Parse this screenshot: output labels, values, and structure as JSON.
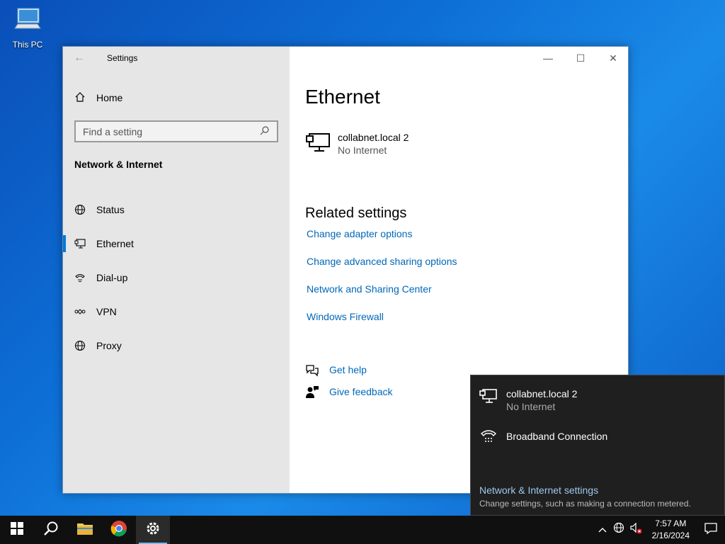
{
  "desktop": {
    "icon_label": "This PC"
  },
  "window": {
    "app_title": "Settings",
    "home_label": "Home",
    "search_placeholder": "Find a setting",
    "section_title": "Network & Internet",
    "nav": [
      {
        "label": "Status",
        "icon": "globe-icon"
      },
      {
        "label": "Ethernet",
        "icon": "ethernet-icon"
      },
      {
        "label": "Dial-up",
        "icon": "dialup-icon"
      },
      {
        "label": "VPN",
        "icon": "vpn-icon"
      },
      {
        "label": "Proxy",
        "icon": "globe-icon"
      }
    ],
    "active_nav": "Ethernet",
    "page_title": "Ethernet",
    "adapter": {
      "name": "collabnet.local 2",
      "status": "No Internet"
    },
    "related_title": "Related settings",
    "related_links": [
      "Change adapter options",
      "Change advanced sharing options",
      "Network and Sharing Center",
      "Windows Firewall"
    ],
    "help": {
      "get_help": "Get help",
      "feedback": "Give feedback"
    }
  },
  "flyout": {
    "network": {
      "name": "collabnet.local 2",
      "status": "No Internet"
    },
    "broadband": "Broadband Connection",
    "settings_title": "Network & Internet settings",
    "settings_desc": "Change settings, such as making a connection metered."
  },
  "taskbar": {
    "time": "7:57 AM",
    "date": "2/16/2024"
  },
  "colors": {
    "accent": "#0078d7",
    "link": "#0067b8",
    "flyout_bg": "#1f1f1f"
  }
}
